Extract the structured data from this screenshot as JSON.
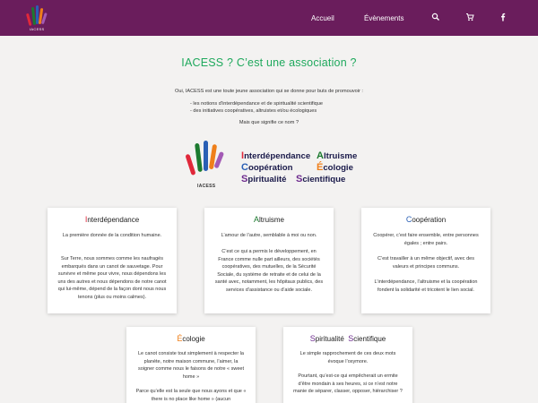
{
  "header": {
    "logo_text": "IACESS",
    "nav": [
      "Accueil",
      "Évènements"
    ],
    "icons": [
      "search-icon",
      "cart-icon",
      "facebook-icon"
    ]
  },
  "colors": {
    "brand": "#6a1d5c",
    "green": "#1fa95d",
    "red": "#e0283a",
    "darkgreen": "#1c7a2f",
    "blue": "#2a5fb5",
    "orange": "#ef7f1a",
    "purple": "#6d2b8e"
  },
  "intro": {
    "title": "IACESS ? C’est une association ?",
    "line1": "Oui, IACESS est une toute jeune association qui se donne pour buts de promouvoir :",
    "bullet1": "- les notions d’interdépendance et de spiritualité scientifique",
    "bullet2": "- des initiatives coopératives, altruistes et/ou écologiques",
    "question": "Mais que signifie ce nom ?"
  },
  "acronym": {
    "logo_text": "IACESS",
    "row1": [
      {
        "cap": "I",
        "rest": "nterdépendance"
      },
      {
        "cap": "A",
        "rest": "ltruisme"
      }
    ],
    "row2": [
      {
        "cap": "C",
        "rest": "oopération"
      },
      {
        "cap": "É",
        "rest": "cologie"
      }
    ],
    "row3": [
      {
        "cap": "S",
        "rest": "piritualité"
      },
      {
        "cap": "S",
        "rest": "cientifique"
      }
    ]
  },
  "cards": [
    {
      "cap": "I",
      "rest": "nterdépendance",
      "paragraphs": [
        "La première donnée de la condition humaine.",
        "Sur Terre, nous sommes comme les naufragés embarqués dans un canot de sauvetage. Pour survivre et même pour vivre, nous dépendons les uns des autres et nous dépendons de notre canot qui lui-même, dépend de la façon dont nous nous tenons (plus ou moins calmes)."
      ]
    },
    {
      "cap": "A",
      "rest": "ltruisme",
      "paragraphs": [
        "L’amour de l’autre, semblable à moi ou non.",
        "C’est ce qui a permis le développement, en France comme nulle part ailleurs, des sociétés coopératives, des mutuelles, de la Sécurité Sociale, du système de retraite et de celui de la santé avec, notamment, les hôpitaux publics, des services d’assistance ou d’aide sociale."
      ]
    },
    {
      "cap": "C",
      "rest": "oopération",
      "paragraphs": [
        "Coopérer, c’est faire ensemble, entre personnes égales ; entre pairs.",
        "C’est travailler à un même objectif, avec des valeurs et principes communs.",
        "L’interdépendance, l’altruisme et la coopération fondent la solidarité et tricotent le lien social."
      ]
    },
    {
      "cap": "É",
      "rest": "cologie",
      "paragraphs": [
        "Le canot consiste tout simplement à respecter la planète, notre maison commune, l’aimer, la soigner comme nous le faisons de notre « sweet home »",
        "Parce qu’elle est la seule que nous ayons et que « there is no place like home » (aucun"
      ]
    },
    {
      "cap": "S",
      "rest": "piritualité",
      "cap2": "S",
      "rest2": "cientifique",
      "paragraphs": [
        "Le simple rapprochement de ces deux mots évoque l’oxymore.",
        "Pourtant, qu’est-ce qui empêcherait un ermite d’être mondain à ses heures, si ce n’est notre manie de séparer, classer, opposer, hiérarchiser ?"
      ]
    }
  ]
}
